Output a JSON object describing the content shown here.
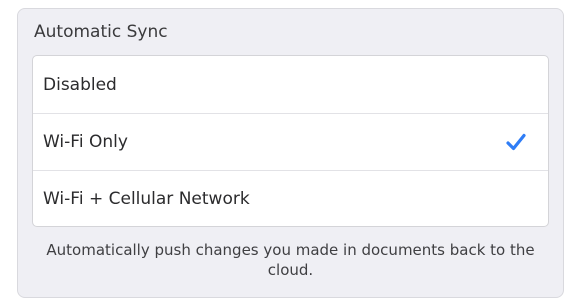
{
  "sync": {
    "header": "Automatic Sync",
    "options": [
      {
        "label": "Disabled",
        "selected": false
      },
      {
        "label": "Wi-Fi Only",
        "selected": true
      },
      {
        "label": "Wi-Fi + Cellular Network",
        "selected": false
      }
    ],
    "selected_icon": "checkmark-icon",
    "accent_color": "#2f7df6",
    "footer": "Automatically push changes you made in documents back to the cloud."
  }
}
